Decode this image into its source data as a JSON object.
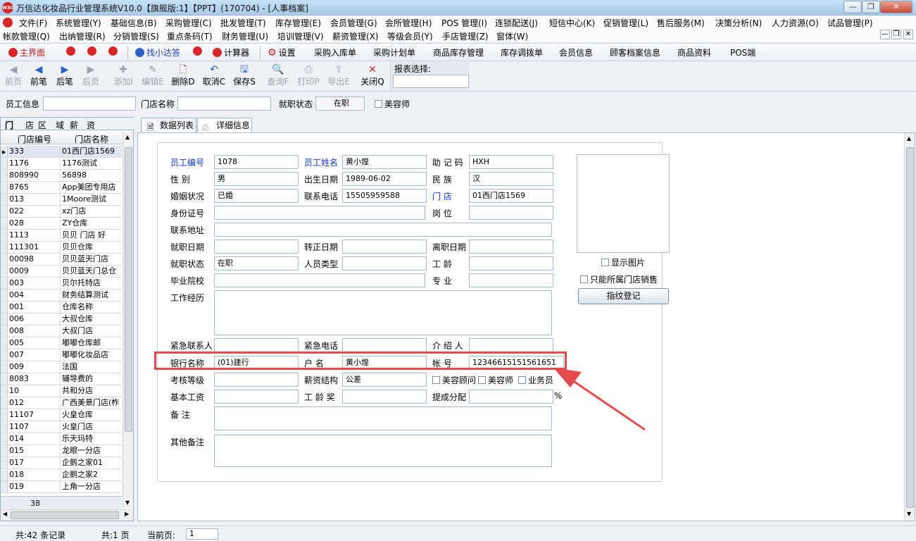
{
  "window": {
    "title": "万信达化妆品行业管理系统V10.0【旗舰版:1】【PPT】(170704) - [人事档案]",
    "minimize": "—",
    "restore": "❐",
    "close": "✕"
  },
  "menu_row1": [
    "文件(F)",
    "系统管理(Y)",
    "基础信息(B)",
    "采购管理(C)",
    "批发管理(T)",
    "库存管理(E)",
    "会员管理(G)",
    "会所管理(H)",
    "POS 管理(I)",
    "连锁配送(J)",
    "短信中心(K)",
    "促销管理(L)",
    "售后服务(M)",
    "决策分析(N)",
    "人力资源(O)",
    "试品管理(P)"
  ],
  "menu_row2": [
    "帐款管理(Q)",
    "出纳管理(R)",
    "分销管理(S)",
    "重点条码(T)",
    "财务管理(U)",
    "培训管理(V)",
    "薪资管理(X)",
    "等级会员(Y)",
    "手店管理(Z)",
    "窗体(W)"
  ],
  "shortcuts": {
    "home": "主界面",
    "find": "找小达答",
    "calc": "计算器",
    "settings": "设置",
    "links": [
      "采购入库单",
      "采购计划单",
      "商品库存管理",
      "库存调拨单",
      "会员信息",
      "顾客档案信息",
      "商品资料",
      "POS端"
    ]
  },
  "toolbar": {
    "buttons": [
      {
        "label": "前页",
        "icon": "◀",
        "enabled": false
      },
      {
        "label": "前笔",
        "icon": "◀",
        "enabled": true
      },
      {
        "label": "后笔",
        "icon": "▶",
        "enabled": true
      },
      {
        "label": "后页",
        "icon": "▶",
        "enabled": false
      },
      {
        "label": "添加I",
        "icon": "✚",
        "enabled": false
      },
      {
        "label": "编辑E",
        "icon": "✎",
        "enabled": false
      },
      {
        "label": "删除D",
        "icon": "🗋",
        "enabled": true
      },
      {
        "label": "取消C",
        "icon": "↶",
        "enabled": true
      },
      {
        "label": "保存S",
        "icon": "🖫",
        "enabled": true
      },
      {
        "label": "查询F",
        "icon": "🔍",
        "enabled": false
      },
      {
        "label": "打印P",
        "icon": "⎙",
        "enabled": false
      },
      {
        "label": "导出E",
        "icon": "⇪",
        "enabled": false
      },
      {
        "label": "关闭Q",
        "icon": "✕",
        "enabled": true
      }
    ],
    "report_label": "报表选择:",
    "report_value": ""
  },
  "filter": {
    "employee_label": "员工信息",
    "employee_value": "",
    "store_label": "门店名称",
    "store_value": "",
    "status_label": "就职状态",
    "status_value": "在职",
    "beautician_label": "美容师"
  },
  "left": {
    "tabs": [
      "门",
      "店",
      "区",
      "域",
      "薪",
      "资"
    ],
    "col1": "门店编号",
    "col2": "门店名称",
    "footer_count": "38",
    "rows": [
      [
        "333",
        "01西门店1569"
      ],
      [
        "1176",
        "1176测试"
      ],
      [
        "808990",
        "56898"
      ],
      [
        "8765",
        "App美团专用店"
      ],
      [
        "013",
        "1Moore测试"
      ],
      [
        "022",
        "xz门店"
      ],
      [
        "028",
        "ZY仓库"
      ],
      [
        "1113",
        "贝贝 门店 好"
      ],
      [
        "111301",
        "贝贝仓库"
      ],
      [
        "00098",
        "贝贝蓝天门店"
      ],
      [
        "0009",
        "贝贝蓝天门总仓"
      ],
      [
        "003",
        "贝尔托特店"
      ],
      [
        "004",
        "财务结算测试"
      ],
      [
        "001",
        "仓库名称"
      ],
      [
        "006",
        "大叔仓库"
      ],
      [
        "008",
        "大叔门店"
      ],
      [
        "005",
        "嘟嘟仓库邮"
      ],
      [
        "007",
        "嘟嘟化妆品店"
      ],
      [
        "009",
        "法国"
      ],
      [
        "8083",
        "辅导费的"
      ],
      [
        "10",
        "共和分店"
      ],
      [
        "012",
        "广西美景门店(柞"
      ],
      [
        "11107",
        "火皇仓库"
      ],
      [
        "1107",
        "火皇门店"
      ],
      [
        "014",
        "乐天玛特"
      ],
      [
        "015",
        "龙眼一分店"
      ],
      [
        "017",
        "企鹅之家01"
      ],
      [
        "018",
        "企鹅之家2"
      ],
      [
        "019",
        "上角一分店"
      ]
    ]
  },
  "tabs": {
    "list": "数据列表",
    "detail": "详细信息"
  },
  "form": {
    "emp_no": {
      "label": "员工编号",
      "value": "1078"
    },
    "emp_name": {
      "label": "员工姓名",
      "value": "黄小煌"
    },
    "mnemonic": {
      "label": "助 记 码",
      "value": "HXH"
    },
    "gender": {
      "label": "性    别",
      "value": "男"
    },
    "birth": {
      "label": "出生日期",
      "value": "1989-06-02"
    },
    "ethnic": {
      "label": "民    族",
      "value": "汉"
    },
    "marital": {
      "label": "婚姻状况",
      "value": "已婚"
    },
    "phone": {
      "label": "联系电话",
      "value": "15505959588"
    },
    "store": {
      "label": "门    店",
      "value": "01西门店1569"
    },
    "id_no": {
      "label": "身份证号",
      "value": ""
    },
    "post": {
      "label": "岗    位",
      "value": ""
    },
    "address": {
      "label": "联系地址",
      "value": ""
    },
    "hire_date": {
      "label": "就职日期",
      "value": ""
    },
    "regular_date": {
      "label": "转正日期",
      "value": ""
    },
    "leave_date": {
      "label": "离职日期",
      "value": ""
    },
    "status": {
      "label": "就职状态",
      "value": "在职"
    },
    "staff_type": {
      "label": "人员类型",
      "value": ""
    },
    "seniority": {
      "label": "工    龄",
      "value": ""
    },
    "school": {
      "label": "毕业院校",
      "value": ""
    },
    "major": {
      "label": "专    业",
      "value": ""
    },
    "work_history": {
      "label": "工作经历",
      "value": ""
    },
    "emergency_contact": {
      "label": "紧急联系人",
      "value": ""
    },
    "emergency_phone": {
      "label": "紧急电话",
      "value": ""
    },
    "referrer": {
      "label": "介 绍 人",
      "value": ""
    },
    "bank": {
      "label": "银行名称",
      "value": "(01)建行"
    },
    "account_name": {
      "label": "户    名",
      "value": "黄小煌"
    },
    "account_no": {
      "label": "帐    号",
      "value": "12346615151561651"
    },
    "grade": {
      "label": "考核等级",
      "value": ""
    },
    "salary_struct": {
      "label": "薪资结构",
      "value": "公差"
    },
    "base_salary": {
      "label": "基本工资",
      "value": ""
    },
    "seniority_bonus": {
      "label": "工 龄 奖",
      "value": ""
    },
    "commission": {
      "label": "提成分配",
      "value": "",
      "unit": "%"
    },
    "remark": {
      "label": "备    注",
      "value": ""
    },
    "other_remark": {
      "label": "其他备注",
      "value": ""
    },
    "chk_advisor": "美容顾问",
    "chk_beautician": "美容师",
    "chk_sales": "业务员",
    "show_photo": "显示图片",
    "only_store_sales": "只能所属门店销售",
    "fingerprint": "指纹登记"
  },
  "status": {
    "records": "共:42 条记录",
    "pages": "共:1 页",
    "current_label": "当前页:",
    "current_value": "1"
  },
  "colors": {
    "highlight": "#e54a4f",
    "blue_label": "#1437d8"
  }
}
